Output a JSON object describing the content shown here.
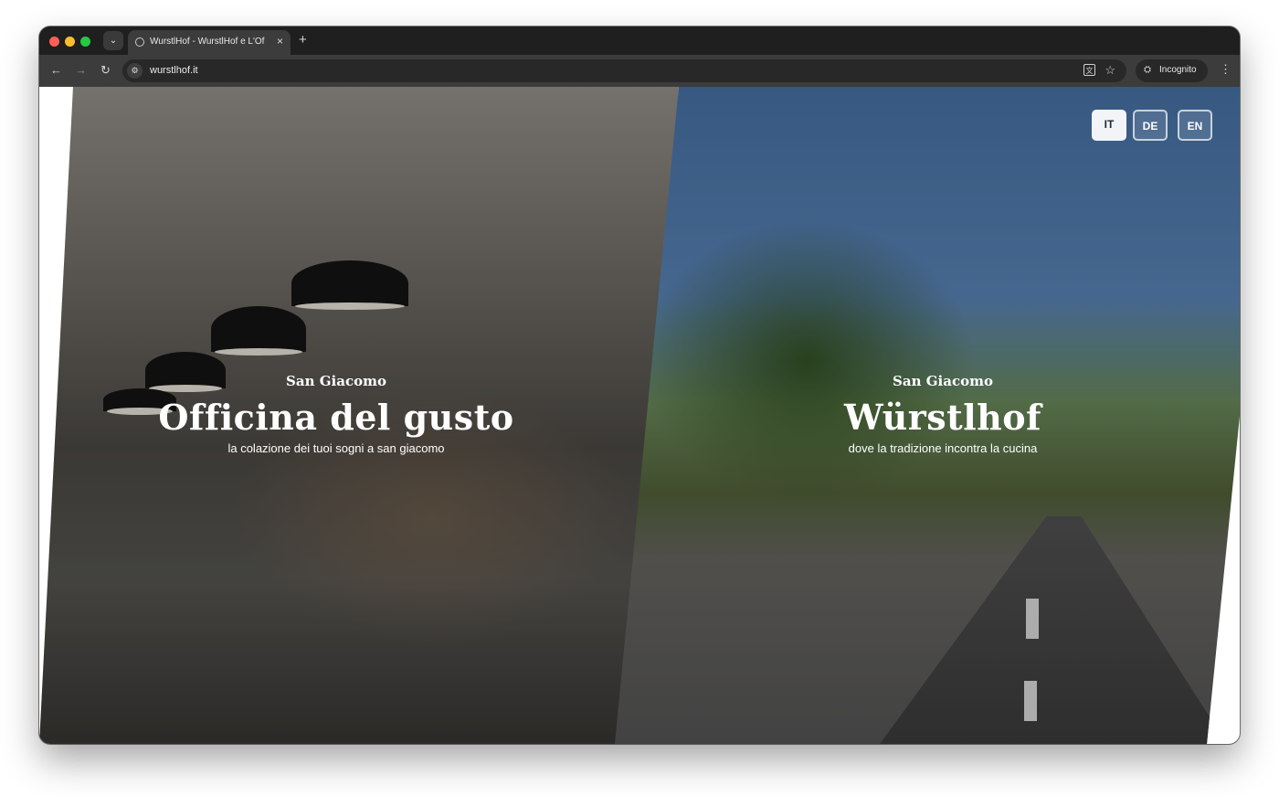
{
  "browser": {
    "tab_title": "WurstlHof - WurstlHof e L'Of",
    "tab_close": "×",
    "new_tab": "+",
    "url": "wurstlhof.it",
    "incognito_label": "Incognito"
  },
  "icons": {
    "tab_search": "⌄",
    "back": "←",
    "forward": "→",
    "reload": "↻",
    "site_info": "⚙",
    "translate": "文",
    "bookmark": "☆",
    "incognito": "⛭",
    "menu": "⋮"
  },
  "colors": {
    "lang_active_bg": "#f2f4f7",
    "lang_active_text": "#1e2a3a",
    "lang_border": "#c9d2de"
  },
  "lang_switch": {
    "active": "IT",
    "options": [
      "IT",
      "DE",
      "EN"
    ]
  },
  "panels": {
    "left": {
      "kicker": "San Giacomo",
      "title": "Officina del gusto",
      "tagline": "la colazione dei tuoi sogni a san giacomo"
    },
    "right": {
      "kicker": "San Giacomo",
      "title": "Würstlhof",
      "tagline": "dove la tradizione incontra la cucina"
    }
  }
}
